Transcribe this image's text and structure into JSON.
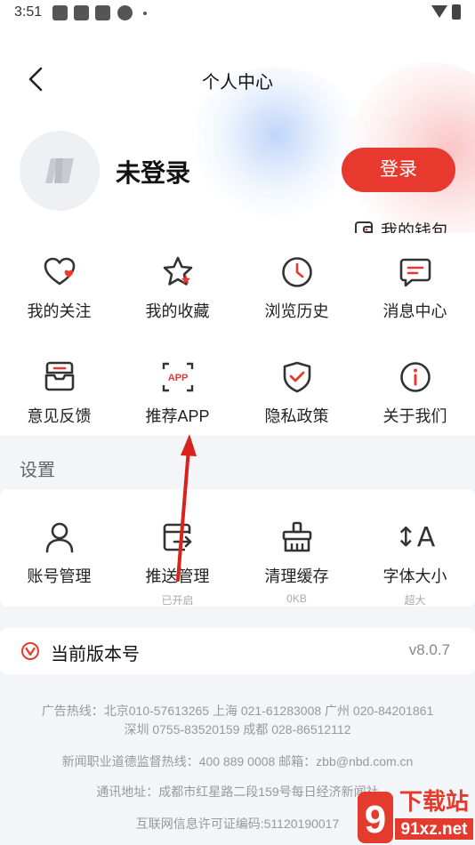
{
  "status_bar": {
    "time": "3:51"
  },
  "header": {
    "title": "个人中心"
  },
  "profile": {
    "username": "未登录",
    "login_label": "登录",
    "wallet_label": "我的钱包"
  },
  "grid": [
    {
      "label": "我的关注",
      "icon": "heart-icon"
    },
    {
      "label": "我的收藏",
      "icon": "star-icon"
    },
    {
      "label": "浏览历史",
      "icon": "clock-icon"
    },
    {
      "label": "消息中心",
      "icon": "message-icon"
    },
    {
      "label": "意见反馈",
      "icon": "feedback-icon"
    },
    {
      "label": "推荐APP",
      "icon": "app-icon",
      "icon_text": "APP"
    },
    {
      "label": "隐私政策",
      "icon": "shield-icon"
    },
    {
      "label": "关于我们",
      "icon": "info-icon"
    }
  ],
  "settings": {
    "title": "设置",
    "items": [
      {
        "label": "账号管理",
        "icon": "user-icon",
        "sub": ""
      },
      {
        "label": "推送管理",
        "icon": "push-icon",
        "sub": "已开启"
      },
      {
        "label": "清理缓存",
        "icon": "broom-icon",
        "sub": "0KB"
      },
      {
        "label": "字体大小",
        "icon": "font-size-icon",
        "icon_text": "↕A",
        "sub": "超大"
      }
    ]
  },
  "version": {
    "label": "当前版本号",
    "value": "v8.0.7"
  },
  "footer": {
    "hotline1": "广告热线：北京010-57613265  上海 021-61283008  广州 020-84201861",
    "hotline2": "深圳 0755-83520159  成都 028-86512112",
    "ethics": "新闻职业道德监督热线：400 889 0008    邮箱：zbb@nbd.com.cn",
    "address": "通讯地址：成都市红星路二段159号每日经济新闻社",
    "license": "互联网信息许可证编码:51120190017"
  },
  "watermark": {
    "text": "下载站",
    "url_text": "91xz.net",
    "logo_text": "9"
  },
  "colors": {
    "accent": "#e8392e",
    "icon_stroke": "#333333",
    "background": "#f3f5f8"
  }
}
